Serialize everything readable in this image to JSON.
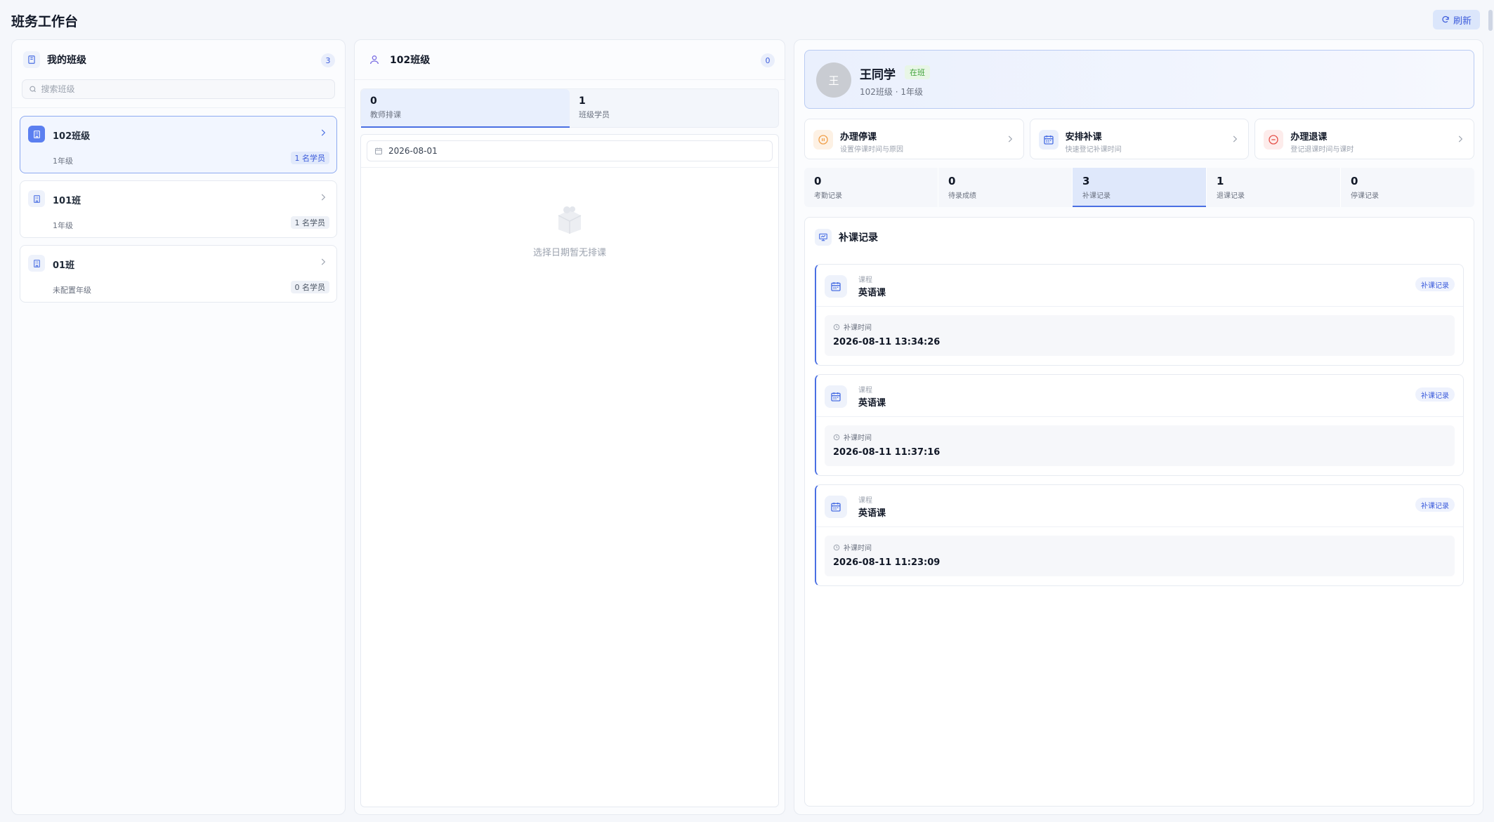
{
  "header": {
    "title": "班务工作台",
    "refresh_label": "刷新"
  },
  "my_classes": {
    "title": "我的班级",
    "count": "3",
    "search_placeholder": "搜索班级",
    "items": [
      {
        "name": "102班级",
        "grade": "1年级",
        "students": "1 名学员",
        "active": true
      },
      {
        "name": "101班",
        "grade": "1年级",
        "students": "1 名学员",
        "active": false
      },
      {
        "name": "01班",
        "grade": "未配置年级",
        "students": "0 名学员",
        "active": false
      }
    ]
  },
  "class_detail": {
    "title": "102班级",
    "count": "0",
    "tabs": [
      {
        "num": "0",
        "label": "教师排课"
      },
      {
        "num": "1",
        "label": "班级学员"
      }
    ],
    "date": "2026-08-01",
    "empty_text": "选择日期暂无排课"
  },
  "student": {
    "avatar": "王",
    "name": "王同学",
    "status": "在班",
    "sub": "102班级 · 1年级",
    "actions": [
      {
        "title": "办理停课",
        "desc": "设置停课时间与原因",
        "icon": "pause-icon",
        "color": "#f0a04b"
      },
      {
        "title": "安排补课",
        "desc": "快速登记补课时间",
        "icon": "calendar-icon",
        "color": "#4a6fe3"
      },
      {
        "title": "办理退课",
        "desc": "登记退课时间与课时",
        "icon": "minus-circle-icon",
        "color": "#e5534b"
      }
    ],
    "stats": [
      {
        "num": "0",
        "label": "考勤记录"
      },
      {
        "num": "0",
        "label": "待录成绩"
      },
      {
        "num": "3",
        "label": "补课记录"
      },
      {
        "num": "1",
        "label": "退课记录"
      },
      {
        "num": "0",
        "label": "停课记录"
      }
    ],
    "records_title": "补课记录",
    "records": [
      {
        "course_label": "课程",
        "course": "英语课",
        "tag": "补课记录",
        "time_label": "补课时间",
        "time": "2026-08-11 13:34:26"
      },
      {
        "course_label": "课程",
        "course": "英语课",
        "tag": "补课记录",
        "time_label": "补课时间",
        "time": "2026-08-11 11:37:16"
      },
      {
        "course_label": "课程",
        "course": "英语课",
        "tag": "补课记录",
        "time_label": "补课时间",
        "time": "2026-08-11 11:23:09"
      }
    ]
  }
}
